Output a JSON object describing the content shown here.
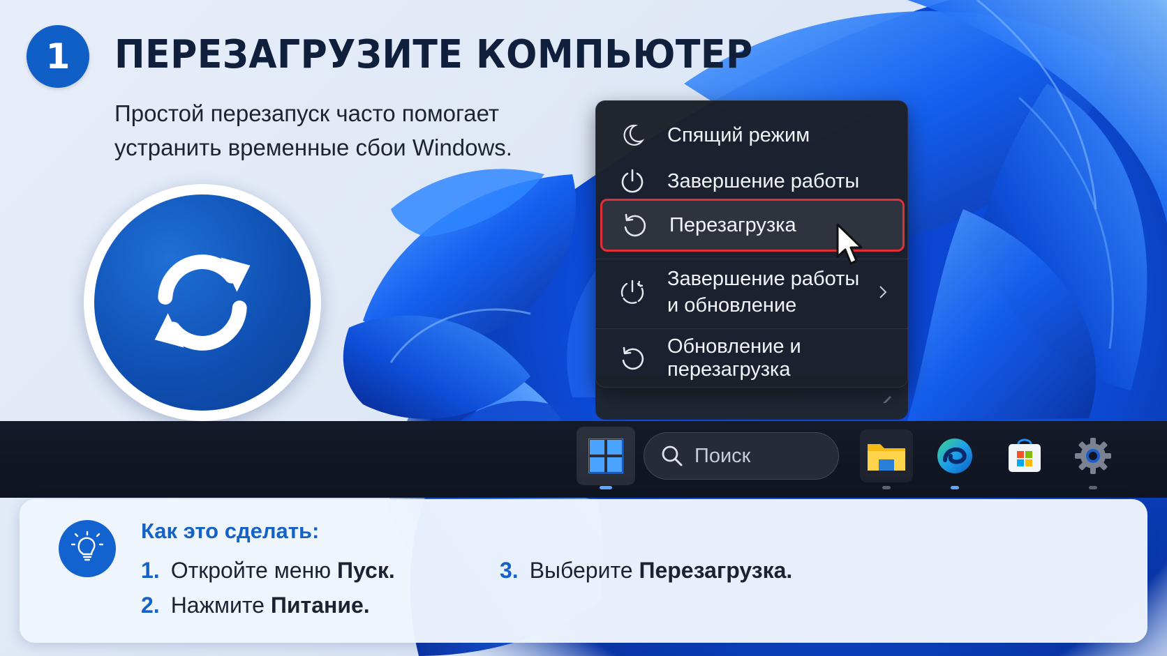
{
  "header": {
    "step_number": "1",
    "title": "ПЕРЕЗАГРУЗИТЕ КОМПЬЮТЕР",
    "subtitle_line1": "Простой перезапуск часто помогает",
    "subtitle_line2": "устранить временные сбои Windows."
  },
  "power_menu": {
    "items": [
      {
        "label": "Спящий режим",
        "icon": "moon-icon"
      },
      {
        "label": "Завершение работы",
        "icon": "power-icon"
      },
      {
        "label": "Перезагрузка",
        "icon": "restart-icon",
        "highlighted": true
      },
      {
        "label_line1": "Завершение работы",
        "label_line2": "и обновление",
        "icon": "power-update-icon",
        "has_submenu": true
      },
      {
        "label": "Обновление и перезагрузка",
        "icon": "update-restart-icon"
      }
    ]
  },
  "taskbar": {
    "search_placeholder": "Поиск",
    "apps": [
      "start-icon",
      "file-explorer-icon",
      "edge-icon",
      "store-icon",
      "settings-icon"
    ]
  },
  "tip": {
    "title": "Как это сделать:",
    "steps": [
      {
        "num": "1.",
        "text": "Откройте меню ",
        "bold": "Пуск",
        "end": "."
      },
      {
        "num": "2.",
        "text": "Нажмите ",
        "bold": "Питание",
        "end": "."
      },
      {
        "num": "3.",
        "text": "Выберите ",
        "bold": "Перезагрузка",
        "end": "."
      }
    ]
  },
  "colors": {
    "accent": "#0f5fc7",
    "highlight_border": "#e0303a",
    "menu_bg": "#1c2028",
    "taskbar_bg": "#141a29"
  }
}
